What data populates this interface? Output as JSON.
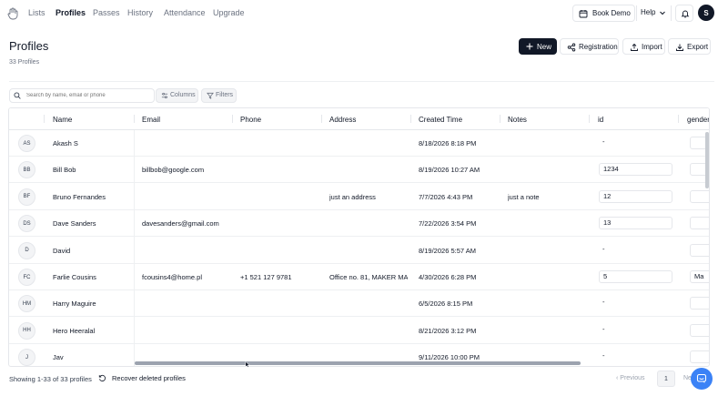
{
  "nav": {
    "items": [
      "Lists",
      "Profiles",
      "Passes",
      "History",
      "Attendance",
      "Upgrade"
    ],
    "active": "Profiles",
    "book_demo": "Book Demo",
    "help": "Help",
    "user_initial": "S"
  },
  "header": {
    "title": "Profiles",
    "count": "33 Profiles",
    "new_label": "New",
    "registration_label": "Registration",
    "import_label": "Import",
    "export_label": "Export"
  },
  "toolbar": {
    "search_placeholder": "Search by name, email or phone",
    "columns_label": "Columns",
    "filters_label": "Filters"
  },
  "table": {
    "columns": [
      "Name",
      "Email",
      "Phone",
      "Address",
      "Created Time",
      "Notes",
      "id",
      "gender"
    ],
    "rows": [
      {
        "initials": "AS",
        "name": "Akash S",
        "email": "",
        "phone": "",
        "address": "",
        "created": "8/18/2026 8:18 PM",
        "notes": "",
        "id": "-",
        "gender": ""
      },
      {
        "initials": "BB",
        "name": "Bill Bob",
        "email": "billbob@google.com",
        "phone": "",
        "address": "",
        "created": "8/19/2026 10:27 AM",
        "notes": "",
        "id": "1234",
        "gender": ""
      },
      {
        "initials": "BF",
        "name": "Bruno Fernandes",
        "email": "",
        "phone": "",
        "address": "just an address",
        "created": "7/7/2026 4:43 PM",
        "notes": "just a note",
        "id": "12",
        "gender": ""
      },
      {
        "initials": "DS",
        "name": "Dave Sanders",
        "email": "davesanders@gmail.com",
        "phone": "",
        "address": "",
        "created": "7/22/2026 3:54 PM",
        "notes": "",
        "id": "13",
        "gender": ""
      },
      {
        "initials": "D",
        "name": "David",
        "email": "",
        "phone": "",
        "address": "",
        "created": "8/19/2026 5:57 AM",
        "notes": "",
        "id": "-",
        "gender": ""
      },
      {
        "initials": "FC",
        "name": "Farlie Cousins",
        "email": "fcousins4@home.pl",
        "phone": "+1 521 127 9781",
        "address": "Office no. 81, MAKER MAXIT",
        "created": "4/30/2026 6:28 PM",
        "notes": "",
        "id": "5",
        "gender": "Ma"
      },
      {
        "initials": "HM",
        "name": "Harry Maguire",
        "email": "",
        "phone": "",
        "address": "",
        "created": "6/5/2026 8:15 PM",
        "notes": "",
        "id": "-",
        "gender": ""
      },
      {
        "initials": "HH",
        "name": "Hero Heeralal",
        "email": "",
        "phone": "",
        "address": "",
        "created": "8/21/2026 3:12 PM",
        "notes": "",
        "id": "-",
        "gender": ""
      },
      {
        "initials": "J",
        "name": "Jav",
        "email": "",
        "phone": "",
        "address": "",
        "created": "9/11/2026 10:00 PM",
        "notes": "",
        "id": "-",
        "gender": ""
      }
    ]
  },
  "footer": {
    "showing": "Showing 1-33 of 33 profiles",
    "recover": "Recover deleted profiles",
    "prev": "Previous",
    "page": "1",
    "next": "Ne"
  },
  "colors": {
    "primary": "#111827",
    "chat": "#3b82f6",
    "muted": "#6b7280",
    "border": "#e5e7eb"
  }
}
